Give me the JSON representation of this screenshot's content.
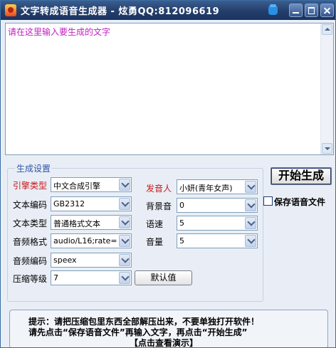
{
  "window": {
    "title": "文字转成语音生成器 - 炫勇QQ:812096619"
  },
  "text_area": {
    "placeholder": "请在这里输入要生成的文字"
  },
  "settings": {
    "group_title": "生成设置",
    "engine": {
      "label": "引擎类型",
      "value": "中文合成引擎"
    },
    "encoding": {
      "label": "文本编码",
      "value": "GB2312"
    },
    "text_type": {
      "label": "文本类型",
      "value": "普通格式文本"
    },
    "audio_format": {
      "label": "音频格式",
      "value": "audio/L16;rate="
    },
    "audio_codec": {
      "label": "音频编码",
      "value": "speex"
    },
    "compression": {
      "label": "压缩等级",
      "value": "7"
    },
    "speaker": {
      "label": "发音人",
      "value": "小妍(青年女声)"
    },
    "bgm": {
      "label": "背景音",
      "value": "0"
    },
    "speed": {
      "label": "语速",
      "value": "5"
    },
    "volume": {
      "label": "音量",
      "value": "5"
    },
    "default_button": "默认值"
  },
  "actions": {
    "start_button": "开始生成",
    "save_audio_label": "保存语音文件",
    "save_audio_checked": false
  },
  "tips": {
    "line1": "提示：请把压缩包里东西全部解压出来，不要单独打开软件！",
    "line2": "请先点击“保存语音文件”再输入文字，再点击“开始生成”",
    "line3": "【点击查看演示】"
  },
  "colors": {
    "title_bar": "#233e6b",
    "window_bg": "#e9eef6",
    "placeholder_text": "#c020c0",
    "accent_label": "#c81818",
    "group_title": "#2f55a5"
  }
}
